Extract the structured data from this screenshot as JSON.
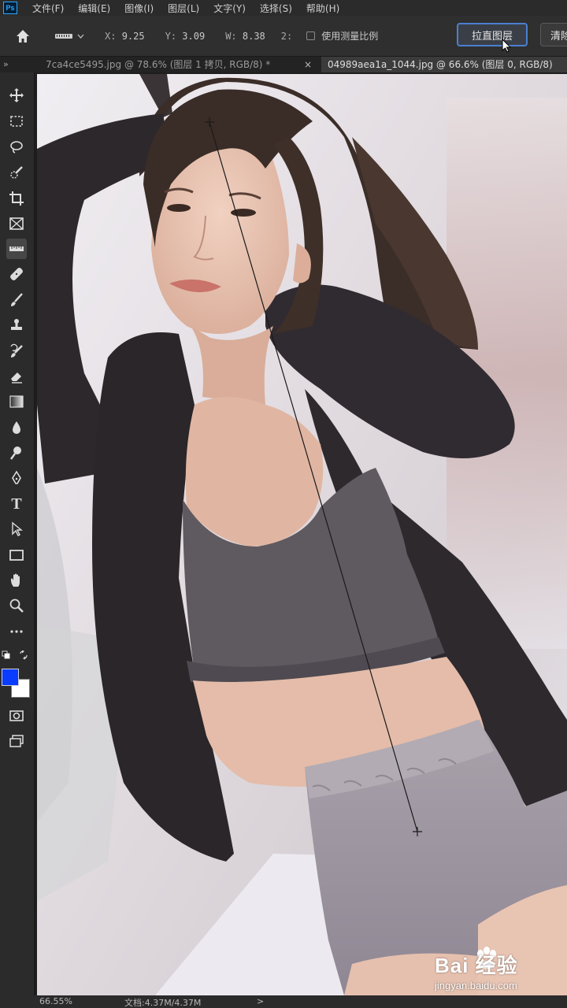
{
  "menubar": {
    "logo": "Ps",
    "items": [
      "文件(F)",
      "编辑(E)",
      "图像(I)",
      "图层(L)",
      "文字(Y)",
      "选择(S)",
      "帮助(H)"
    ]
  },
  "options": {
    "x_label": "X:",
    "x_value": "9.25",
    "y_label": "Y:",
    "y_value": "3.09",
    "w_label": "W:",
    "w_value": "8.38",
    "a_label": "2:",
    "use_scale_label": "使用测量比例",
    "straighten_label": "拉直图层",
    "clear_label": "清除"
  },
  "tabs": [
    {
      "label": "7ca4ce5495.jpg @ 78.6% (图层 1 拷贝, RGB/8) *",
      "close": "×"
    },
    {
      "label": "04989aea1a_1044.jpg @ 66.6% (图层 0, RGB/8)"
    }
  ],
  "colors": {
    "foreground": "#0a3cff",
    "background": "#ffffff",
    "accent": "#4b7fd0"
  },
  "tools": [
    "move-icon",
    "marquee-icon",
    "lasso-icon",
    "quick-select-icon",
    "crop-icon",
    "frame-icon",
    "ruler-icon",
    "healing-icon",
    "brush-icon",
    "stamp-icon",
    "history-brush-icon",
    "eraser-icon",
    "gradient-icon",
    "blur-icon",
    "dodge-icon",
    "pen-icon",
    "type-icon",
    "path-select-icon",
    "rectangle-icon",
    "hand-icon",
    "zoom-icon",
    "more-icon"
  ],
  "type_tool_glyph": "T",
  "status": {
    "zoom": "66.55%",
    "doc": "文档:4.37M/4.37M",
    "arrow": ">"
  },
  "watermark": {
    "brand": "Bai 经验",
    "url": "jingyan.baidu.com"
  }
}
